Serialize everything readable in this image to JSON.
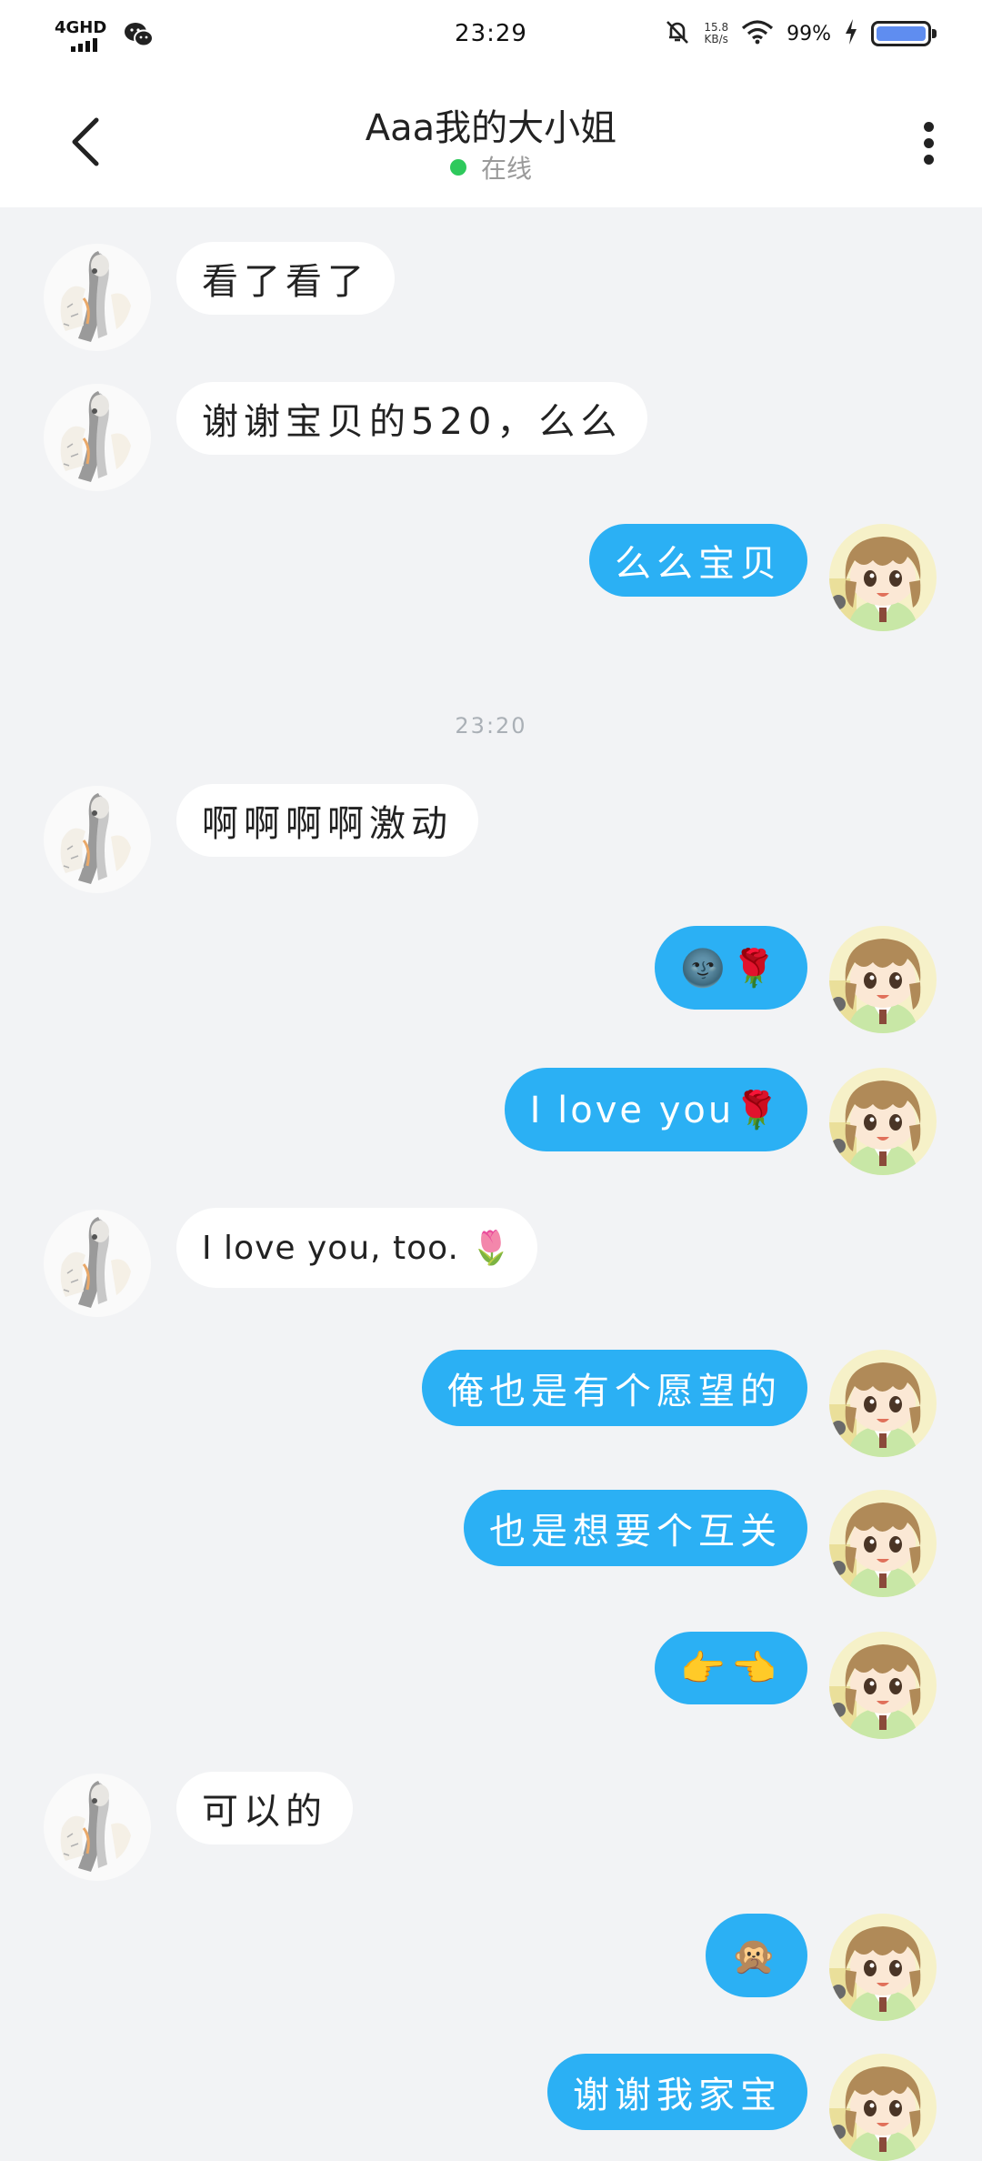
{
  "status_bar": {
    "network": "4GHD",
    "time": "23:29",
    "speed_value": "15.8",
    "speed_unit": "KB/s",
    "battery": "99%"
  },
  "header": {
    "title": "Aaa我的大小姐",
    "status": "在线"
  },
  "colors": {
    "outgoing_bubble": "#2bb0f4",
    "incoming_bubble": "#ffffff",
    "online_dot": "#2ec95c",
    "background": "#f2f3f5"
  },
  "messages": [
    {
      "side": "in",
      "text": "看了看了"
    },
    {
      "side": "in",
      "text": "谢谢宝贝的520，么么"
    },
    {
      "side": "out",
      "text": "么么宝贝"
    },
    {
      "type": "timestamp",
      "text": "23:20"
    },
    {
      "side": "in",
      "text": "啊啊啊啊激动"
    },
    {
      "side": "out",
      "text": "🌚🌹"
    },
    {
      "side": "out",
      "text": "I love you🌹"
    },
    {
      "side": "in",
      "text": "I love you, too. 🌷"
    },
    {
      "side": "out",
      "text": "俺也是有个愿望的"
    },
    {
      "side": "out",
      "text": "也是想要个互关"
    },
    {
      "side": "out",
      "text": "👉👈"
    },
    {
      "side": "in",
      "text": "可以的"
    },
    {
      "side": "out",
      "text": "🙊"
    },
    {
      "side": "out",
      "text": "谢谢我家宝"
    }
  ]
}
